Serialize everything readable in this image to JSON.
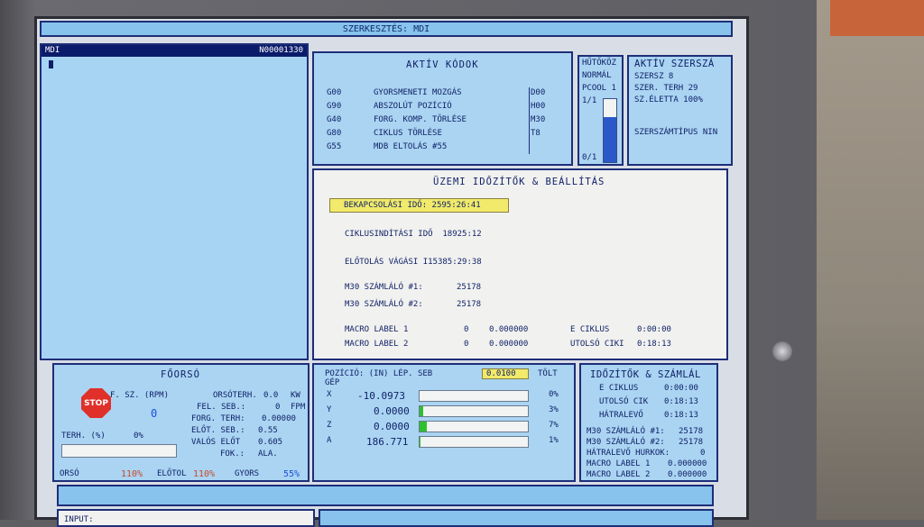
{
  "title": "SZERKESZTÉS: MDI",
  "mdi": {
    "label": "MDI",
    "program": "N00001330"
  },
  "active_codes": {
    "title": "AKTÍV KÓDOK",
    "rows": [
      {
        "code": "G00",
        "desc": "GYORSMENETI MOZGÁS",
        "extra": "D00"
      },
      {
        "code": "G90",
        "desc": "ABSZOLÚT POZÍCIÓ",
        "extra": "H00"
      },
      {
        "code": "G40",
        "desc": "FORG. KOMP. TÖRLÉSE",
        "extra": "M30"
      },
      {
        "code": "G80",
        "desc": "CIKLUS TÖRLÉSE",
        "extra": "T8"
      },
      {
        "code": "G55",
        "desc": "MDB ELTOLÁS #55",
        "extra": ""
      }
    ]
  },
  "coolant": {
    "title": "HŰTŐKÖZ",
    "status": "NORMÁL",
    "pcool": "PCOOL 1",
    "top": "1/1",
    "bottom": "0/1",
    "level": 0.72
  },
  "active_tool": {
    "title": "AKTÍV SZERSZÁ",
    "tool": "SZERSZ 8",
    "load": "SZER. TERH 29",
    "life": "SZ.ÉLETTA 100%",
    "type": "SZERSZÁMTÍPUS NIN"
  },
  "timers": {
    "title": "ÜZEMI IDŐZÍTŐK & BEÁLLÍTÁS",
    "power_on": "BEKAPCSOLÁSI IDŐ: 2595:26:41",
    "cycle_start": "CIKLUSINDÍTÁSI IDŐ  18925:12",
    "feed_cut": "ELŐTOLÁS VÁGÁSI I15385:29:38",
    "m30_1_label": "M30 SZÁMLÁLÓ #1:",
    "m30_1": "25178",
    "m30_2_label": "M30 SZÁMLÁLÓ #2:",
    "m30_2": "25178",
    "macro1_label": "MACRO LABEL 1",
    "macro1_a": "0",
    "macro1_b": "0.000000",
    "macro2_label": "MACRO LABEL 2",
    "macro2_a": "0",
    "macro2_b": "0.000000",
    "e_cycle_label": "E CIKLUS",
    "e_cycle": "0:00:00",
    "last_cycle_label": "UTOLSÓ CIKI",
    "last_cycle": "0:18:13"
  },
  "spindle": {
    "title": "FŐORSÓ",
    "stop": "STOP",
    "speed_label": "F. SZ. (RPM)",
    "speed": "0",
    "load_label": "ORSÓTERH.",
    "load": "0.0",
    "load_unit": "KW",
    "surf_label": "FEL. SEB.:",
    "surf": "0",
    "surf_unit": "FPM",
    "chip_label": "FORG. TERH:",
    "chip": "0.00000",
    "feed_label": "ELŐT. SEB.:",
    "feed": "0.55",
    "actual_label": "VALÓS ELŐT",
    "actual": "0.605",
    "gear_label": "FOK.:",
    "gear": "ALA.",
    "terh_label": "TERH. (%)",
    "terh": "0%",
    "ovr_spindle_label": "ORSÓ",
    "ovr_spindle": "110%",
    "ovr_feed_label": "ELŐTOL",
    "ovr_feed": "110%",
    "ovr_rapid_label": "GYORS",
    "ovr_rapid": "55%"
  },
  "position": {
    "header": "POZÍCIÓ: (IN) LÉP. SEB",
    "step": "0.0100",
    "fill_label": "TÖLT",
    "sub": "GÉP",
    "axes": [
      {
        "axis": "X",
        "value": "-10.0973",
        "pct": "0%",
        "load": 0.0
      },
      {
        "axis": "Y",
        "value": "0.0000",
        "pct": "3%",
        "load": 0.03
      },
      {
        "axis": "Z",
        "value": "0.0000",
        "pct": "7%",
        "load": 0.07
      },
      {
        "axis": "A",
        "value": "186.771",
        "pct": "1%",
        "load": 0.01
      }
    ]
  },
  "timers_counters": {
    "title": "IDŐZÍTŐK & SZÁMLÁL",
    "e_cycle_label": "E CIKLUS",
    "e_cycle": "0:00:00",
    "last_label": "UTOLSÓ CIK",
    "last": "0:18:13",
    "remain_label": "HÁTRALEVŐ",
    "remain": "0:18:13",
    "m30_1_label": "M30 SZÁMLÁLÓ #1:",
    "m30_1": "25178",
    "m30_2_label": "M30 SZÁMLÁLÓ #2:",
    "m30_2": "25178",
    "loops_label": "HÁTRALEVŐ HURKOK:",
    "loops": "0",
    "macro1_label": "MACRO LABEL 1",
    "macro1": "0.000000",
    "macro2_label": "MACRO LABEL 2",
    "macro2": "0.000000"
  },
  "input_label": "INPUT:",
  "colors": {
    "panel": "#aad4f2",
    "border": "#1e2e78",
    "text": "#0e1f66",
    "highlight": "#f1ea6a",
    "override": "#c84a28",
    "rapid": "#1c4fd6"
  }
}
